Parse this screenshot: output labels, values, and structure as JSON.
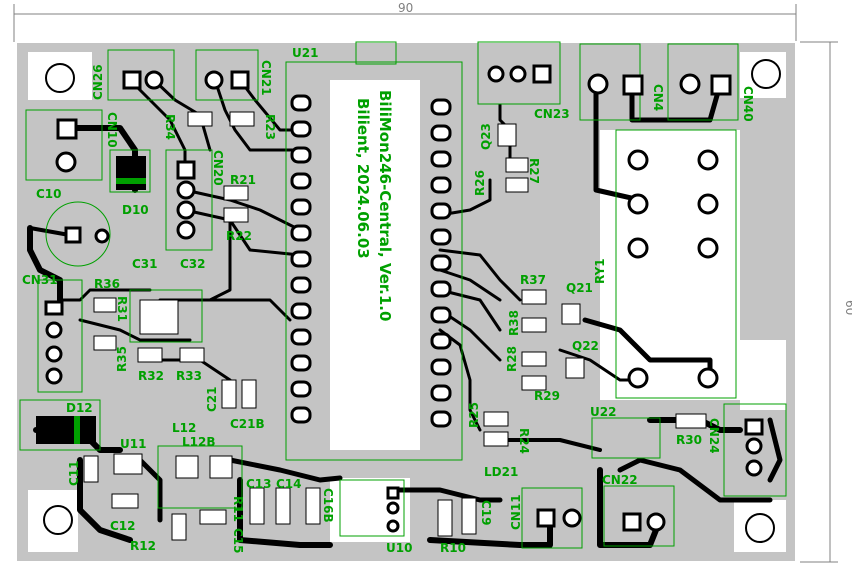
{
  "board": {
    "width_label": "90",
    "height_label": "60",
    "silkscreen_text_line1": "BiliMon246-Central, Ver.1.0",
    "silkscreen_text_line2": "Bilient, 2024.06.03"
  },
  "colors": {
    "board": "#c4c4c4",
    "copper": "#000000",
    "silkscreen": "#00a000",
    "pad": "#ffffff",
    "dimension": "#808080"
  },
  "labels": {
    "CN26": "CN26",
    "CN21": "CN21",
    "CN10": "CN10",
    "CN20": "CN20",
    "U21": "U21",
    "CN23": "CN23",
    "CN4": "CN4",
    "CN40": "CN40",
    "R34": "R34",
    "R23": "R23",
    "R21": "R21",
    "R22": "R22",
    "C10": "C10",
    "D10": "D10",
    "Q23": "Q23",
    "R26": "R26",
    "R27": "R27",
    "RY1": "RY1",
    "CN31": "CN31",
    "C31": "C31",
    "C32": "C32",
    "R36": "R36",
    "R31": "R31",
    "R35": "R35",
    "R32": "R32",
    "R33": "R33",
    "R37": "R37",
    "Q21": "Q21",
    "R38": "R38",
    "Q22": "Q22",
    "R28": "R28",
    "R29": "R29",
    "D12": "D12",
    "C21": "C21",
    "C21B": "C21B",
    "R25": "R25",
    "R24": "R24",
    "U22": "U22",
    "R30": "R30",
    "CN24": "CN24",
    "L12": "L12",
    "L12B": "L12B",
    "U11": "U11",
    "C11": "C11",
    "LD21": "LD21",
    "CN22": "CN22",
    "C13": "C13",
    "C14": "C14",
    "C16B": "C16B",
    "C12": "C12",
    "R11": "R11",
    "C15": "C15",
    "R12": "R12",
    "U10": "U10",
    "R10": "R10",
    "CN11": "CN11",
    "C19": "C19"
  }
}
